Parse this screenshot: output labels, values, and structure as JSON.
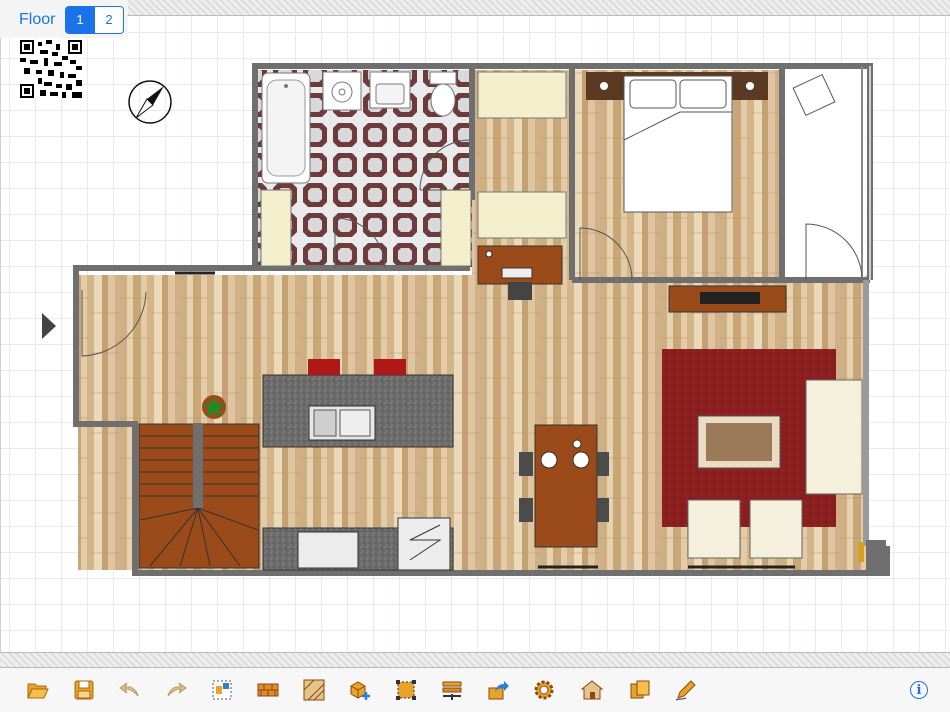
{
  "floor_selector": {
    "label": "Floor",
    "floors": [
      "1",
      "2"
    ],
    "selected": "1"
  },
  "colors": {
    "accent": "#1a73e8",
    "wall": "#7a7a7a",
    "wood_floor": "#d8bc94",
    "tile_floor": "#efeff0",
    "rug": "#8b1f1f",
    "stairs": "#9b4a1a",
    "counter": "#6a6a6a"
  },
  "toolbar": {
    "tools": [
      {
        "name": "open-icon"
      },
      {
        "name": "save-icon"
      },
      {
        "name": "undo-icon"
      },
      {
        "name": "redo-icon"
      },
      {
        "name": "plan-view-icon"
      },
      {
        "name": "wall-icon"
      },
      {
        "name": "room-icon"
      },
      {
        "name": "add-object-icon"
      },
      {
        "name": "select-area-icon"
      },
      {
        "name": "layers-icon"
      },
      {
        "name": "share-icon"
      },
      {
        "name": "settings-icon"
      },
      {
        "name": "3d-view-icon"
      },
      {
        "name": "catalog-icon"
      },
      {
        "name": "pencil-icon"
      }
    ],
    "info_label": "i"
  }
}
